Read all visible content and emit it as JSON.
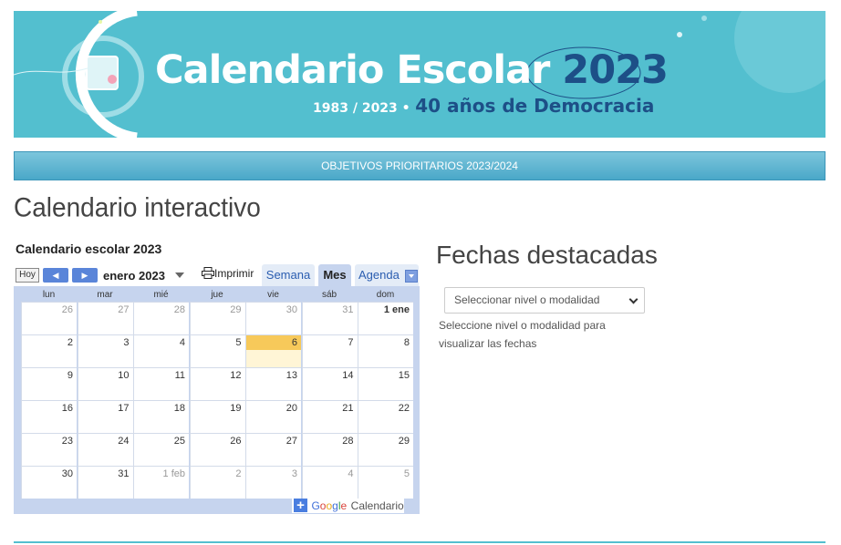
{
  "banner": {
    "title": "Calendario Escolar",
    "year": "2023",
    "subtitle_small": "1983 / 2023 •",
    "subtitle_big": "40 años de Democracia"
  },
  "nav": {
    "label": "OBJETIVOS PRIORITARIOS 2023/2024"
  },
  "page_title": "Calendario interactivo",
  "calendar": {
    "title": "Calendario escolar 2023",
    "today_button": "Hoy",
    "prev_icon": "◀",
    "next_icon": "▶",
    "month": "enero 2023",
    "print_label": "Imprimir",
    "tabs": [
      "Semana",
      "Mes",
      "Agenda"
    ],
    "active_tab": "Mes",
    "weekdays": [
      "lun",
      "mar",
      "mié",
      "jue",
      "vie",
      "sáb",
      "dom"
    ],
    "weeks": [
      [
        {
          "d": "26",
          "o": true
        },
        {
          "d": "27",
          "o": true
        },
        {
          "d": "28",
          "o": true
        },
        {
          "d": "29",
          "o": true
        },
        {
          "d": "30",
          "o": true
        },
        {
          "d": "31",
          "o": true
        },
        {
          "d": "1 ene",
          "o": false,
          "b": true
        }
      ],
      [
        {
          "d": "2"
        },
        {
          "d": "3"
        },
        {
          "d": "4"
        },
        {
          "d": "5"
        },
        {
          "d": "6",
          "t": true
        },
        {
          "d": "7"
        },
        {
          "d": "8"
        }
      ],
      [
        {
          "d": "9"
        },
        {
          "d": "10"
        },
        {
          "d": "11"
        },
        {
          "d": "12"
        },
        {
          "d": "13"
        },
        {
          "d": "14"
        },
        {
          "d": "15"
        }
      ],
      [
        {
          "d": "16"
        },
        {
          "d": "17"
        },
        {
          "d": "18"
        },
        {
          "d": "19"
        },
        {
          "d": "20"
        },
        {
          "d": "21"
        },
        {
          "d": "22"
        }
      ],
      [
        {
          "d": "23"
        },
        {
          "d": "24"
        },
        {
          "d": "25"
        },
        {
          "d": "26"
        },
        {
          "d": "27"
        },
        {
          "d": "28"
        },
        {
          "d": "29"
        }
      ],
      [
        {
          "d": "30"
        },
        {
          "d": "31"
        },
        {
          "d": "1 feb",
          "o": true
        },
        {
          "d": "2",
          "o": true
        },
        {
          "d": "3",
          "o": true
        },
        {
          "d": "4",
          "o": true
        },
        {
          "d": "5",
          "o": true
        }
      ]
    ],
    "footer_plus": "+",
    "footer_brand": "Google",
    "footer_label": "Calendario"
  },
  "featured": {
    "title": "Fechas destacadas",
    "select_value": "Seleccionar nivel o modalidad",
    "help": "Seleccione nivel o modalidad para visualizar las fechas"
  }
}
